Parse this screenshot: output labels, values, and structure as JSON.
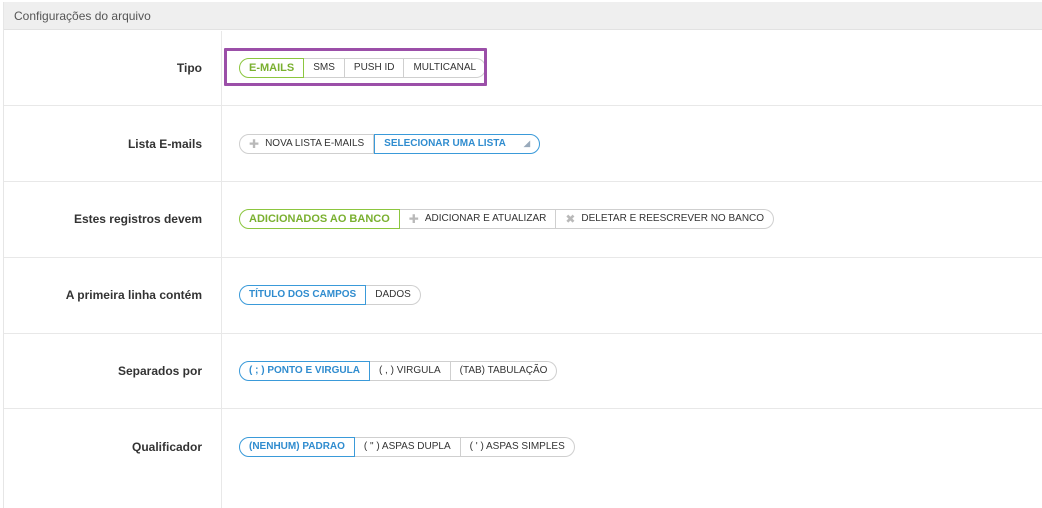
{
  "section": {
    "title": "Configurações do arquivo"
  },
  "rows": {
    "tipo": {
      "label": "Tipo",
      "options": [
        "E-MAILS",
        "SMS",
        "PUSH ID",
        "MULTICANAL"
      ]
    },
    "lista": {
      "label": "Lista E-mails",
      "new_list": "NOVA LISTA E-MAILS",
      "select_list": "SELECIONAR UMA LISTA"
    },
    "registros": {
      "label": "Estes registros devem",
      "options": [
        "ADICIONADOS AO BANCO",
        "ADICIONAR E ATUALIZAR",
        "DELETAR E REESCREVER NO BANCO"
      ]
    },
    "primeira": {
      "label": "A primeira linha contém",
      "options": [
        "TÍTULO DOS CAMPOS",
        "DADOS"
      ]
    },
    "separados": {
      "label": "Separados por",
      "options": [
        "( ; ) PONTO E VIRGULA",
        "( , ) VIRGULA",
        "(TAB) TABULAÇÃO"
      ]
    },
    "qualificador": {
      "label": "Qualificador",
      "options": [
        "(NENHUM) PADRAO",
        "( \" ) ASPAS DUPLA",
        "( ' ) ASPAS SIMPLES"
      ]
    }
  },
  "icons": {
    "add": "plus-icon",
    "delete": "x-icon",
    "dropdown": "caret-icon"
  },
  "colors": {
    "green": "#8cc63f",
    "blue": "#3a9ad9",
    "highlight": "#9b4fa8"
  }
}
